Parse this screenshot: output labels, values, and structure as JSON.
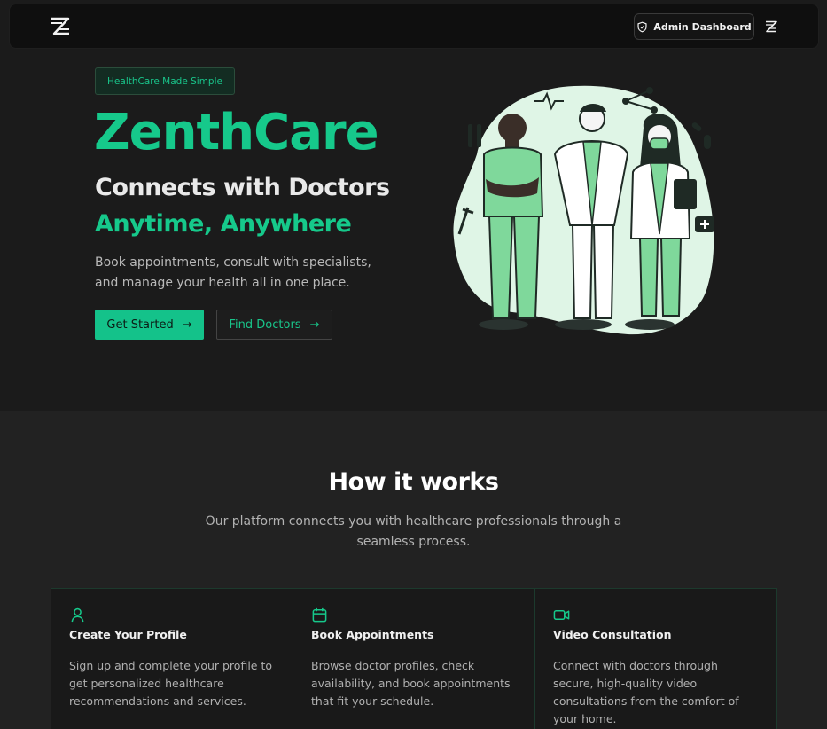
{
  "nav": {
    "admin_label": "Admin Dashboard"
  },
  "hero": {
    "badge": "HealthCare Made Simple",
    "title": "ZenthCare",
    "subtitle_line1": "Connects with Doctors",
    "subtitle_line2": "Anytime, Anywhere",
    "description": "Book appointments, consult with specialists, and manage your health all in one place.",
    "primary_button": "Get Started",
    "secondary_button": "Find Doctors"
  },
  "how_it_works": {
    "title": "How it works",
    "description": "Our platform connects you with healthcare professionals through a seamless process.",
    "cards": [
      {
        "icon": "user-icon",
        "title": "Create Your Profile",
        "description": "Sign up and complete your profile to get personalized healthcare recommendations and services."
      },
      {
        "icon": "calendar-icon",
        "title": "Book Appointments",
        "description": "Browse doctor profiles, check availability, and book appointments that fit your schedule."
      },
      {
        "icon": "video-icon",
        "title": "Video Consultation",
        "description": "Connect with doctors through secure, high-quality video consultations from the comfort of your home."
      }
    ]
  },
  "colors": {
    "accent": "#16c98b",
    "background": "#1b1b1b",
    "section_background": "#222222"
  }
}
